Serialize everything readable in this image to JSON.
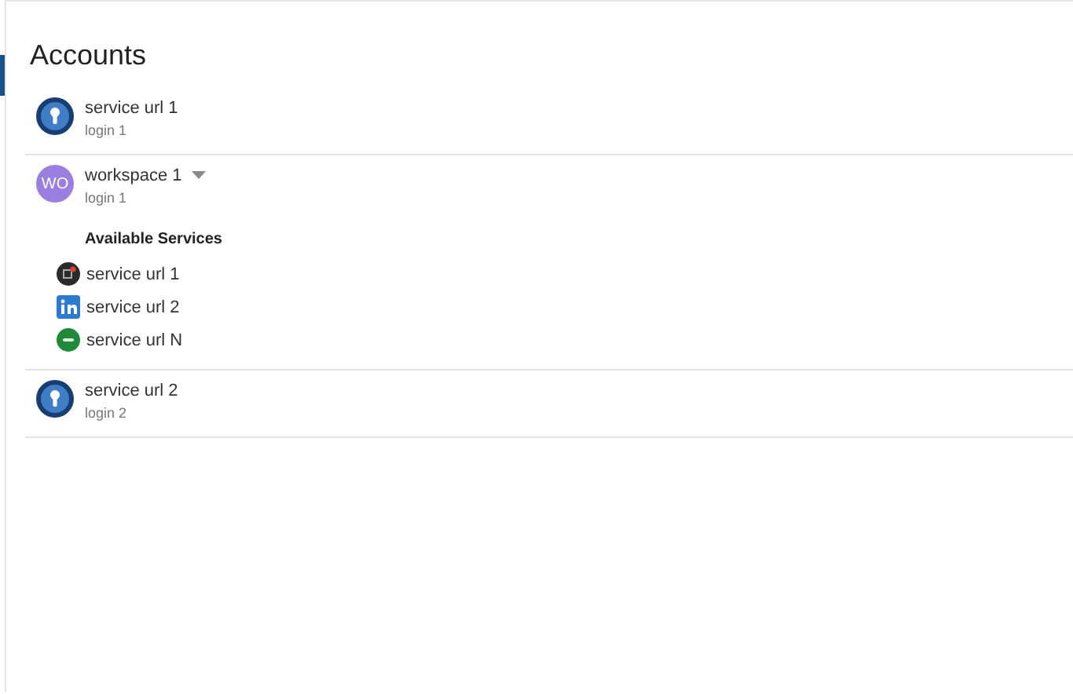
{
  "title": "Accounts",
  "accounts": [
    {
      "kind": "service",
      "name": "service url 1",
      "login": "login 1"
    },
    {
      "kind": "workspace",
      "name": "workspace 1",
      "login": "login 1",
      "avatar": "WO",
      "expanded": true,
      "services_heading": "Available Services",
      "services": [
        {
          "kind": "record",
          "name": "service url 1"
        },
        {
          "kind": "social",
          "name": "service url 2"
        },
        {
          "kind": "badge",
          "name": "service url N"
        }
      ]
    },
    {
      "kind": "service",
      "name": "service url 2",
      "login": "login 2"
    }
  ]
}
